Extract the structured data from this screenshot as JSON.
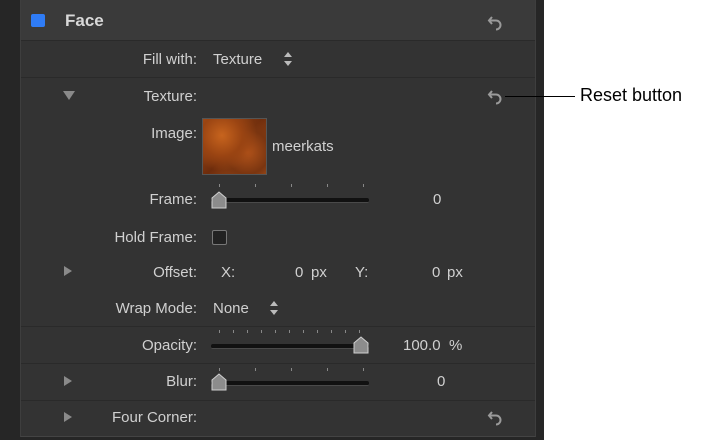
{
  "header": {
    "title": "Face"
  },
  "fill_with": {
    "label": "Fill with:",
    "value": "Texture"
  },
  "texture": {
    "label": "Texture:"
  },
  "image": {
    "label": "Image:",
    "name": "meerkats"
  },
  "frame": {
    "label": "Frame:",
    "value": "0",
    "slider_fraction": 0.0
  },
  "hold_frame": {
    "label": "Hold Frame:",
    "checked": false
  },
  "offset": {
    "label": "Offset:",
    "x_label": "X:",
    "x_value": "0",
    "x_unit": "px",
    "y_label": "Y:",
    "y_value": "0",
    "y_unit": "px"
  },
  "wrap_mode": {
    "label": "Wrap Mode:",
    "value": "None"
  },
  "opacity": {
    "label": "Opacity:",
    "value": "100.0",
    "unit": "%",
    "slider_fraction": 1.0
  },
  "blur": {
    "label": "Blur:",
    "value": "0",
    "slider_fraction": 0.0
  },
  "four_corner": {
    "label": "Four Corner:"
  },
  "callout": {
    "text": "Reset button"
  },
  "colors": {
    "panel_bg": "#333333",
    "header_checkbox": "#2f7cf6",
    "text": "#d0d0d0"
  }
}
